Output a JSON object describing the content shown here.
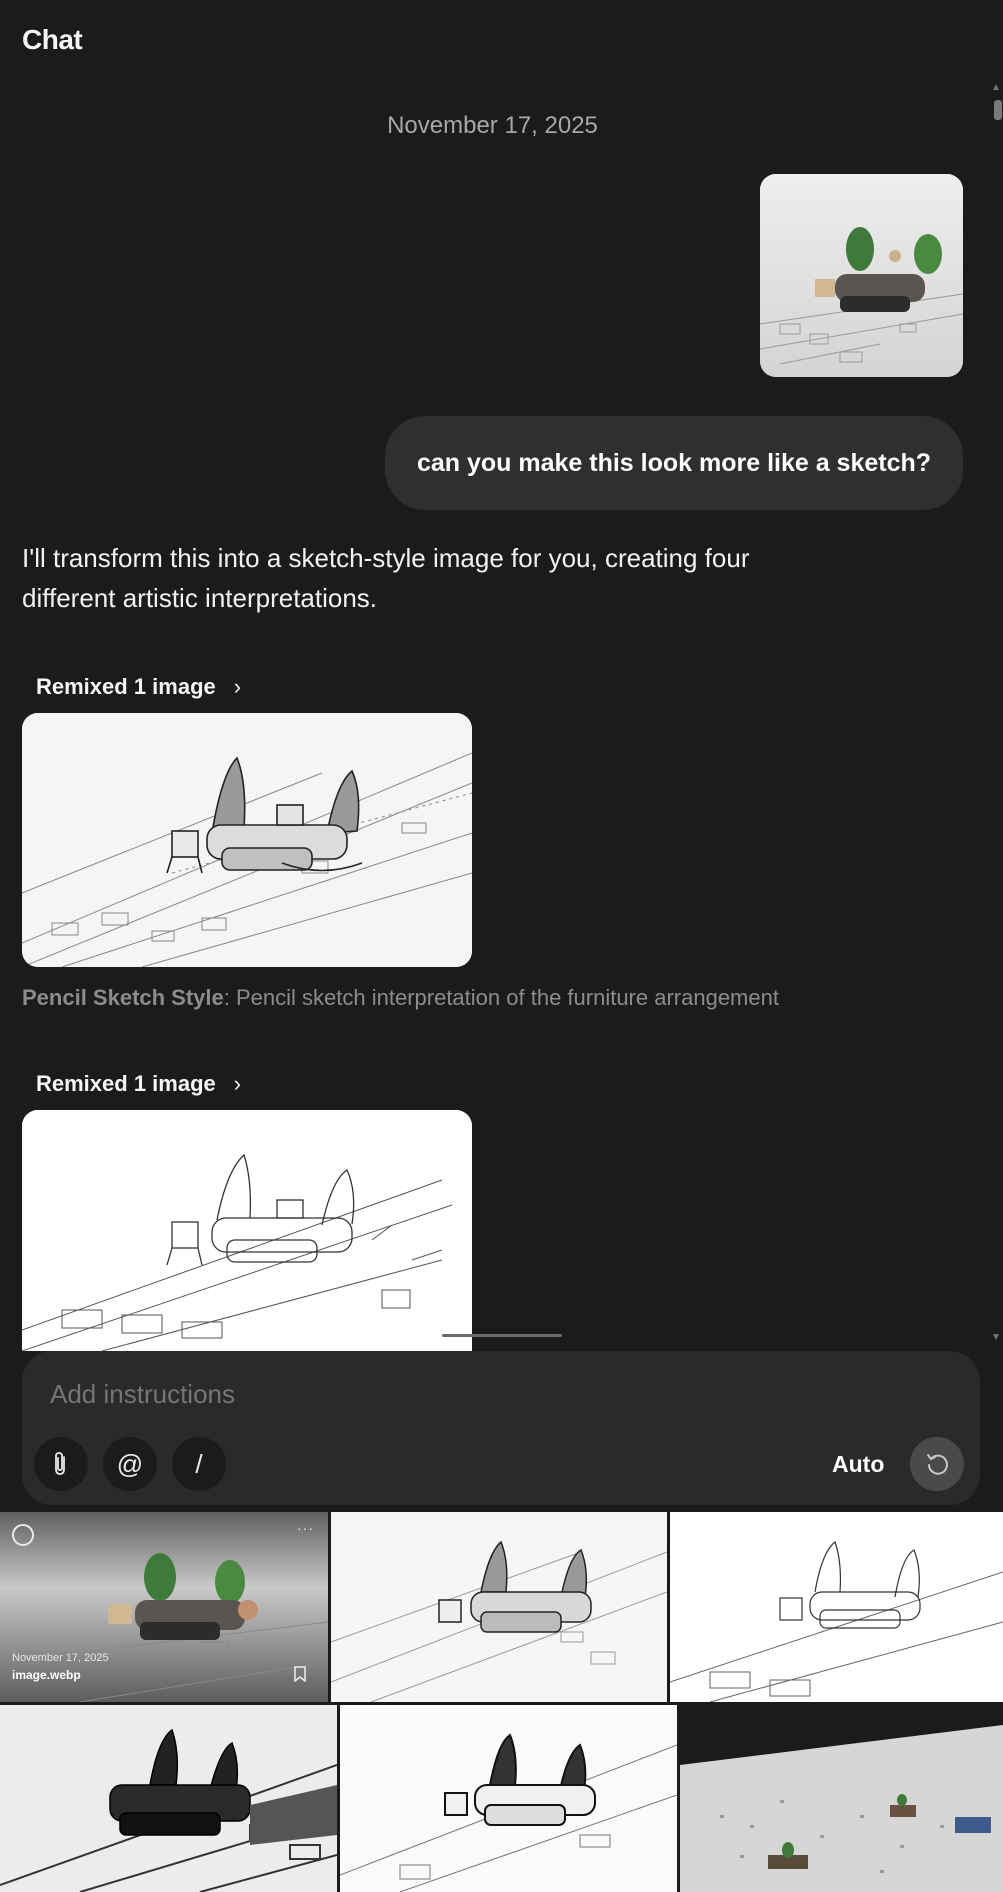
{
  "header": {
    "title": "Chat"
  },
  "conversation": {
    "date": "November 17, 2025",
    "user_message": "can you make this look more like a sketch?",
    "assistant_message": "I'll transform this into a sketch-style image for you, creating four different artistic interpretations.",
    "remix_blocks": [
      {
        "label": "Remixed 1 image",
        "chevron": "›"
      },
      {
        "label": "Remixed 1 image",
        "chevron": "›"
      }
    ],
    "caption": {
      "title": "Pencil Sketch Style",
      "separator": ":",
      "text": " Pencil sketch interpretation of the furniture arrangement"
    }
  },
  "composer": {
    "placeholder": "Add instructions",
    "mode": "Auto",
    "buttons": {
      "attach": "paperclip-icon",
      "mention": "@",
      "command": "/"
    }
  },
  "gallery": {
    "first_item": {
      "date": "November 17, 2025",
      "filename": "image.webp",
      "menu": "···"
    }
  }
}
